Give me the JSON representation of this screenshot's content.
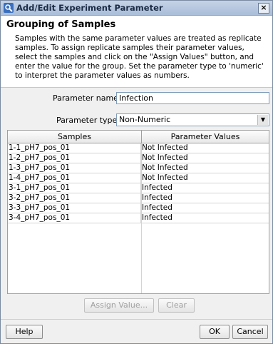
{
  "window": {
    "title": "Add/Edit Experiment Parameter",
    "close_label": "×"
  },
  "header": {
    "title": "Grouping of Samples",
    "description": "Samples with the same parameter values are treated as replicate samples. To assign replicate samples their parameter values, select the samples and click on the \"Assign Values\" button, and enter the value for the group. Set the parameter type to 'numeric' to interpret the parameter values as numbers."
  },
  "form": {
    "name_label": "Parameter name",
    "name_value": "Infection",
    "type_label": "Parameter type",
    "type_value": "Non-Numeric"
  },
  "table": {
    "headers": [
      "Samples",
      "Parameter Values"
    ],
    "rows": [
      [
        "1-1_pH7_pos_01",
        "Not Infected"
      ],
      [
        "1-2_pH7_pos_01",
        "Not Infected"
      ],
      [
        "1-3_pH7_pos_01",
        "Not Infected"
      ],
      [
        "1-4_pH7_pos_01",
        "Not Infected"
      ],
      [
        "3-1_pH7_pos_01",
        "Infected"
      ],
      [
        "3-2_pH7_pos_01",
        "Infected"
      ],
      [
        "3-3_pH7_pos_01",
        "Infected"
      ],
      [
        "3-4_pH7_pos_01",
        "Infected"
      ]
    ]
  },
  "buttons": {
    "assign": "Assign Value...",
    "clear": "Clear",
    "help": "Help",
    "ok": "OK",
    "cancel": "Cancel"
  }
}
